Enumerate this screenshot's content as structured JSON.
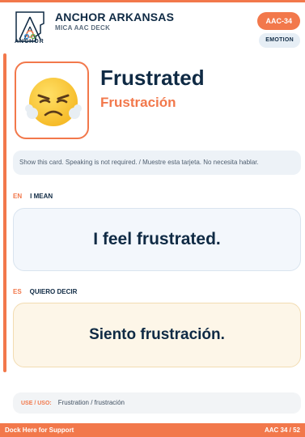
{
  "header": {
    "logo_word": "ANCHOR",
    "brand_title": "ANCHOR ARKANSAS",
    "brand_subtitle": "MICA AAC DECK",
    "card_code": "AAC-34",
    "category": "EMOTION"
  },
  "card": {
    "emoji_icon": "frustrated-face-icon",
    "title_en": "Frustrated",
    "title_es": "Frustración",
    "note": "Show this card. Speaking is not required. / Muestre esta tarjeta. No necesita hablar.",
    "en": {
      "code": "EN",
      "label": "I MEAN",
      "phrase": "I feel frustrated."
    },
    "es": {
      "code": "ES",
      "label": "QUIERO DECIR",
      "phrase": "Siento frustración."
    },
    "use_label": "USE / USO:",
    "use_value": "Frustration / frustración"
  },
  "footer": {
    "left": "Dock Here for Support",
    "right": "AAC 34 / 52"
  },
  "colors": {
    "accent": "#f2784b",
    "navy": "#0f2a44",
    "en_panel": "#f3f7fc",
    "es_panel": "#fdf6e8"
  }
}
